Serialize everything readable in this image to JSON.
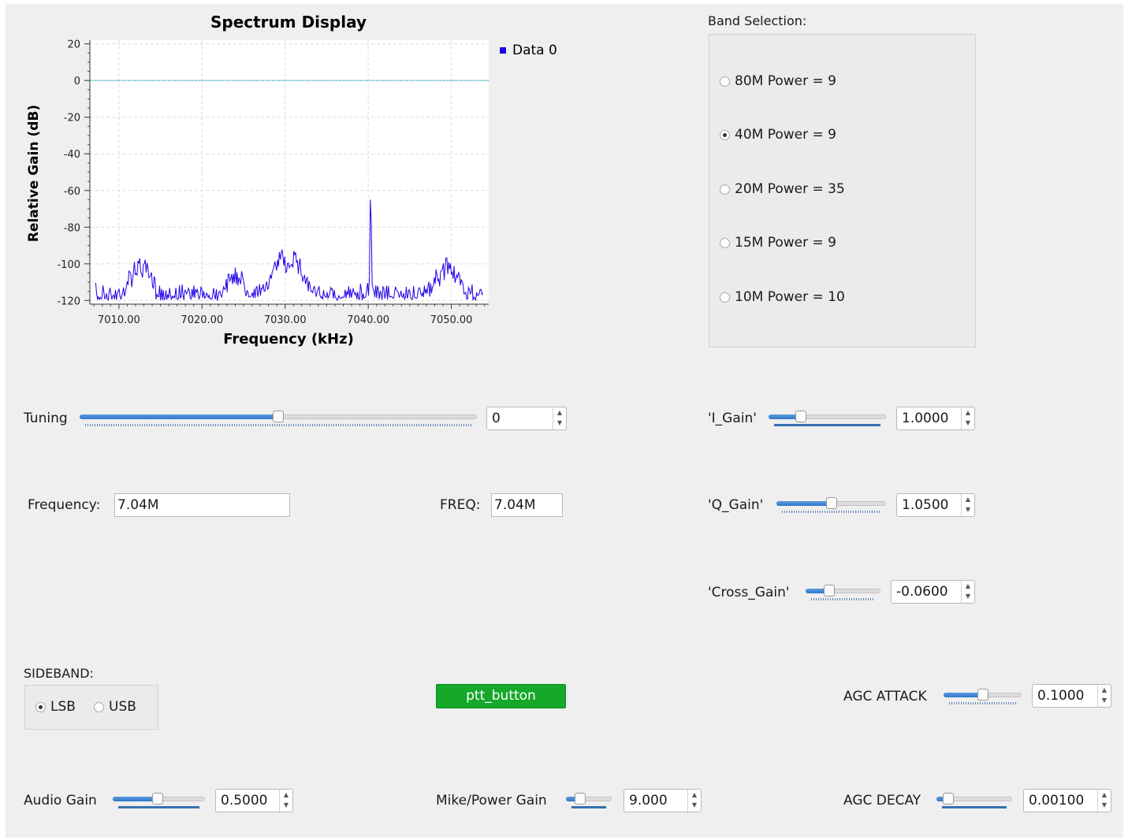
{
  "chart_data": {
    "type": "line",
    "title": "Spectrum Display",
    "xlabel": "Frequency (kHz)",
    "ylabel": "Relative Gain (dB)",
    "xlim": [
      7006.5,
      7054.5
    ],
    "ylim": [
      -122,
      22
    ],
    "x_ticks": [
      "7010.00",
      "7020.00",
      "7030.00",
      "7040.00",
      "7050.00"
    ],
    "y_ticks": [
      "20",
      "0",
      "-20",
      "-40",
      "-60",
      "-80",
      "-100",
      "-120"
    ],
    "reference_line": 0,
    "grid": true,
    "legend": "top-right outside",
    "series": [
      {
        "name": "Data 0",
        "color": "#1f00e6",
        "peaks": [
          {
            "x": 7007.5,
            "y": -118
          },
          {
            "x": 7012.5,
            "y": -97
          },
          {
            "x": 7024.0,
            "y": -102
          },
          {
            "x": 7029.5,
            "y": -94
          },
          {
            "x": 7031.0,
            "y": -93
          },
          {
            "x": 7040.3,
            "y": -65
          },
          {
            "x": 7049.5,
            "y": -97
          }
        ],
        "noise_floor": -112
      }
    ]
  },
  "band": {
    "title": "Band Selection:",
    "options": [
      "80M Power = 9",
      "40M Power = 9",
      "20M Power = 35",
      "15M Power = 9",
      "10M Power = 10"
    ],
    "selected": "40M Power = 9"
  },
  "tuning": {
    "label": "Tuning",
    "value": "0",
    "level": 0.5
  },
  "frequency": {
    "label": "Frequency:",
    "value": "7.04M"
  },
  "freq": {
    "label": "FREQ:",
    "value": "7.04M"
  },
  "i_gain": {
    "label": "'I_Gain'",
    "value": "1.0000",
    "level": 0.28
  },
  "q_gain": {
    "label": "'Q_Gain'",
    "value": "1.0500",
    "level": 0.5
  },
  "cross_gain": {
    "label": "'Cross_Gain'",
    "value": "-0.0600",
    "level": 0.3
  },
  "sideband": {
    "title": "SIDEBAND:",
    "options": [
      "LSB",
      "USB"
    ],
    "selected": "LSB"
  },
  "ptt": {
    "label": "ptt_button",
    "color": "#16a829"
  },
  "agc_attack": {
    "label": "AGC ATTACK",
    "value": "0.1000",
    "level": 0.5
  },
  "agc_decay": {
    "label": "AGC DECAY",
    "value": "0.00100",
    "level": 0.1
  },
  "audio_gain": {
    "label": "Audio Gain",
    "value": "0.5000",
    "level": 0.5
  },
  "mike_gain": {
    "label": "Mike/Power Gain",
    "value": "9.000",
    "level": 0.3
  }
}
